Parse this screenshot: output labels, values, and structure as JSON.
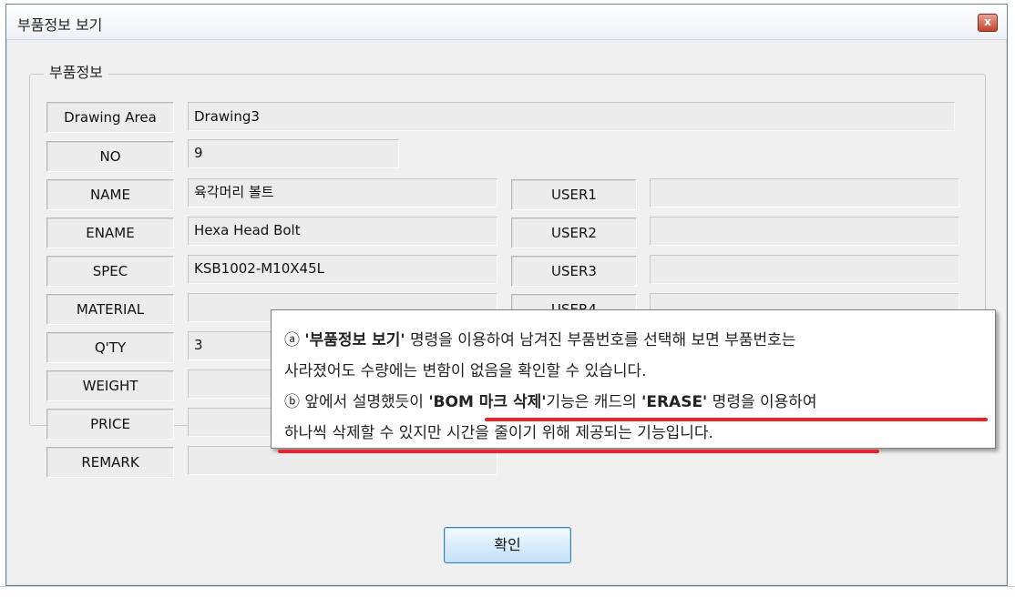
{
  "window": {
    "title": "부품정보 보기",
    "close_glyph": "x"
  },
  "group": {
    "title": "부품정보"
  },
  "fields": {
    "drawing_area": {
      "label": "Drawing Area",
      "value": "Drawing3"
    },
    "no": {
      "label": "NO",
      "value": "9"
    },
    "name": {
      "label": "NAME",
      "value": "육각머리 볼트"
    },
    "ename": {
      "label": "ENAME",
      "value": "Hexa Head Bolt"
    },
    "spec": {
      "label": "SPEC",
      "value": "KSB1002-M10X45L"
    },
    "material": {
      "label": "MATERIAL",
      "value": ""
    },
    "qty": {
      "label": "Q'TY",
      "value": "3"
    },
    "weight": {
      "label": "WEIGHT",
      "value": ""
    },
    "price": {
      "label": "PRICE",
      "value": ""
    },
    "remark": {
      "label": "REMARK",
      "value": ""
    },
    "user1": {
      "label": "USER1",
      "value": ""
    },
    "user2": {
      "label": "USER2",
      "value": ""
    },
    "user3": {
      "label": "USER3",
      "value": ""
    },
    "user4": {
      "label": "USER4",
      "value": ""
    }
  },
  "ok_label": "확인",
  "callout": {
    "line1_marker": "ⓐ",
    "line1_bold": "'부품정보 보기'",
    "line1_rest": " 명령을 이용하여 남겨진 부품번호를 선택해 보면 부품번호는",
    "line2": "사라졌어도 수량에는 변함이 없음을 확인할 수 있습니다.",
    "line3_pre": "ⓑ 앞에서 설명했듯이 ",
    "line3_bold1": "'BOM 마크 삭제'",
    "line3_mid": "기능은 캐드의 ",
    "line3_bold2": "'ERASE'",
    "line3_end": " 명령을 이용하여",
    "line4": "하나씩 삭제할 수 있지만 시간을 줄이기 위해 제공되는 기능입니다.",
    "underline_color": "#e8232b"
  }
}
